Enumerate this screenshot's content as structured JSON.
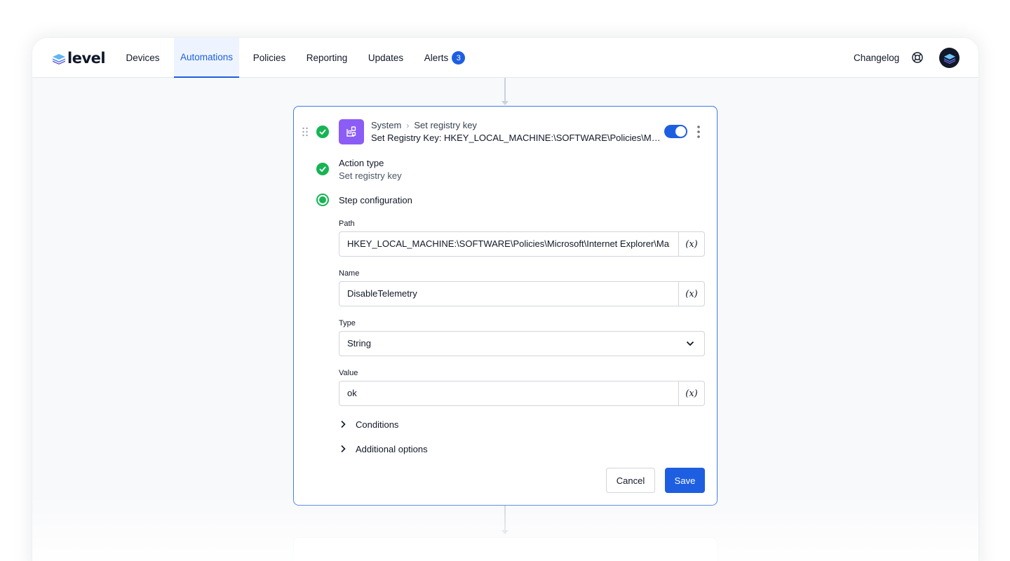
{
  "brand": {
    "logo_text": "level",
    "accent_color": "#1d5fe0"
  },
  "nav": {
    "items": [
      {
        "label": "Devices",
        "active": false
      },
      {
        "label": "Automations",
        "active": true
      },
      {
        "label": "Policies",
        "active": false
      },
      {
        "label": "Reporting",
        "active": false
      },
      {
        "label": "Updates",
        "active": false
      },
      {
        "label": "Alerts",
        "active": false,
        "badge": "3"
      }
    ],
    "changelog_label": "Changelog",
    "icons": {
      "help": "lifebuoy-icon",
      "avatar": "level-logo-avatar"
    }
  },
  "step": {
    "breadcrumb": {
      "category": "System",
      "action": "Set registry key"
    },
    "title": "Set Registry Key: HKEY_LOCAL_MACHINE:\\SOFTWARE\\Policies\\Microsoft\\Internet Explorer\\Main",
    "enabled": true,
    "status": "complete",
    "tile_color": "#8b5cf6",
    "action_type": {
      "heading": "Action type",
      "value": "Set registry key"
    },
    "configuration": {
      "heading": "Step configuration",
      "fields": {
        "path": {
          "label": "Path",
          "value": "HKEY_LOCAL_MACHINE:\\SOFTWARE\\Policies\\Microsoft\\Internet Explorer\\Main"
        },
        "name": {
          "label": "Name",
          "value": "DisableTelemetry"
        },
        "type": {
          "label": "Type",
          "value": "String"
        },
        "value": {
          "label": "Value",
          "value": "ok"
        }
      },
      "variable_button_label": "(x)"
    },
    "conditions_label": "Conditions",
    "additional_options_label": "Additional options",
    "cancel_label": "Cancel",
    "save_label": "Save"
  }
}
